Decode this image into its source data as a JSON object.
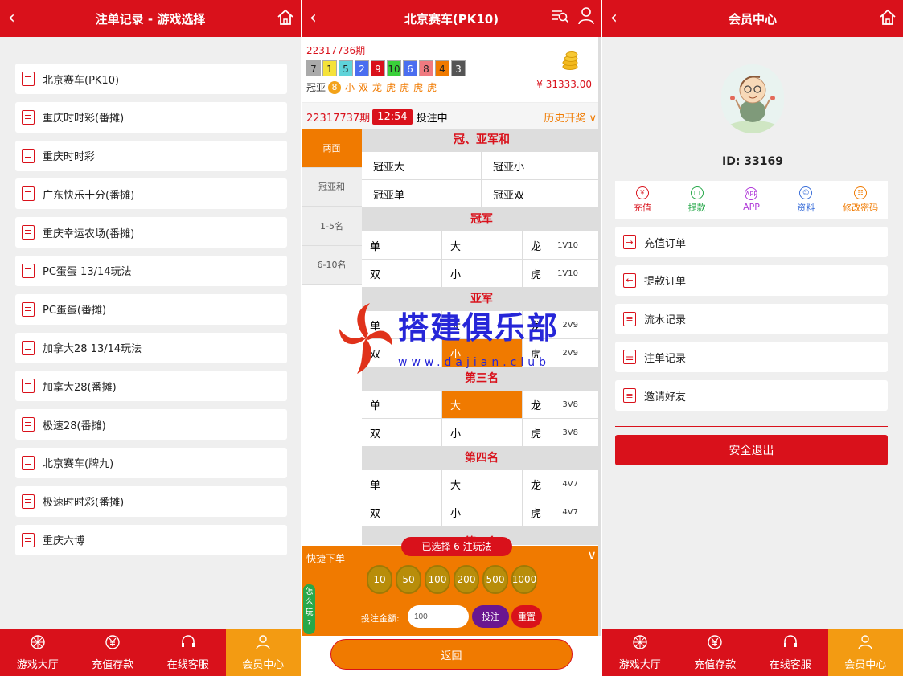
{
  "left": {
    "title": "注单记录 - 游戏选择",
    "games": [
      "北京赛车(PK10)",
      "重庆时时彩(番摊)",
      "重庆时时彩",
      "广东快乐十分(番摊)",
      "重庆幸运农场(番摊)",
      "PC蛋蛋 13/14玩法",
      "PC蛋蛋(番摊)",
      "加拿大28 13/14玩法",
      "加拿大28(番摊)",
      "极速28(番摊)",
      "北京赛车(牌九)",
      "极速时时彩(番摊)",
      "重庆六博"
    ]
  },
  "tabs": [
    "游戏大厅",
    "充值存款",
    "在线客服",
    "会员中心"
  ],
  "middle": {
    "title": "北京赛车(PK10)",
    "last_period": "22317736期",
    "balls": [
      {
        "n": "7",
        "color": "#aaaaaa"
      },
      {
        "n": "1",
        "color": "#f5e23a"
      },
      {
        "n": "5",
        "color": "#5fd3d9"
      },
      {
        "n": "2",
        "color": "#4a6ef0"
      },
      {
        "n": "9",
        "color": "#d9111b"
      },
      {
        "n": "10",
        "color": "#3ad03a"
      },
      {
        "n": "6",
        "color": "#4a6ef0"
      },
      {
        "n": "8",
        "color": "#f07a80"
      },
      {
        "n": "4",
        "color": "#f07a00"
      },
      {
        "n": "3",
        "color": "#555555"
      }
    ],
    "sum_label": "冠亚",
    "sum_value": "8",
    "sum_tags": [
      "小",
      "双",
      "龙",
      "虎",
      "虎",
      "虎",
      "虎"
    ],
    "balance": "¥ 31333.00",
    "current_period": "22317737期",
    "countdown": "12:54",
    "status": "投注中",
    "history": "历史开奖",
    "side_menu": [
      "两面",
      "冠亚和",
      "1-5名",
      "6-10名"
    ],
    "sec_guanya": "冠、亚军和",
    "guanya": [
      [
        "冠亚大",
        "冠亚小"
      ],
      [
        "冠亚单",
        "冠亚双"
      ]
    ],
    "sections": [
      {
        "title": "冠军",
        "rows": [
          [
            "单",
            "大",
            "龙",
            "1V10"
          ],
          [
            "双",
            "小",
            "虎",
            "1V10"
          ]
        ]
      },
      {
        "title": "亚军",
        "rows": [
          [
            "单",
            "大",
            "龙",
            "2V9"
          ],
          [
            "双",
            "小",
            "虎",
            "2V9"
          ]
        ]
      },
      {
        "title": "第三名",
        "rows": [
          [
            "单",
            "大",
            "龙",
            "3V8"
          ],
          [
            "双",
            "小",
            "虎",
            "3V8"
          ]
        ]
      },
      {
        "title": "第四名",
        "rows": [
          [
            "单",
            "大",
            "龙",
            "4V7"
          ],
          [
            "双",
            "小",
            "虎",
            "4V7"
          ]
        ]
      }
    ],
    "sec_partial": "第五名",
    "watermark": "搭建俱乐部",
    "watermark_url": "www.dajian.club",
    "quick_title": "快捷下单",
    "chosen": "已选择 6 注玩法",
    "chips": [
      "10",
      "50",
      "100",
      "200",
      "500",
      "1000"
    ],
    "how_to_play": "怎么玩?",
    "amount_label": "投注金额:",
    "amount_value": "100",
    "bet_btn": "投注",
    "reset_btn": "重置",
    "back_btn": "返回"
  },
  "right": {
    "title": "会员中心",
    "user_id": "ID: 33169",
    "actions": [
      "充值",
      "提款",
      "APP",
      "资料",
      "修改密码"
    ],
    "menu": [
      "充值订单",
      "提款订单",
      "流水记录",
      "注单记录",
      "邀请好友"
    ],
    "logout": "安全退出"
  },
  "colors": {
    "primary": "#d9111b",
    "accent": "#f07a00"
  }
}
